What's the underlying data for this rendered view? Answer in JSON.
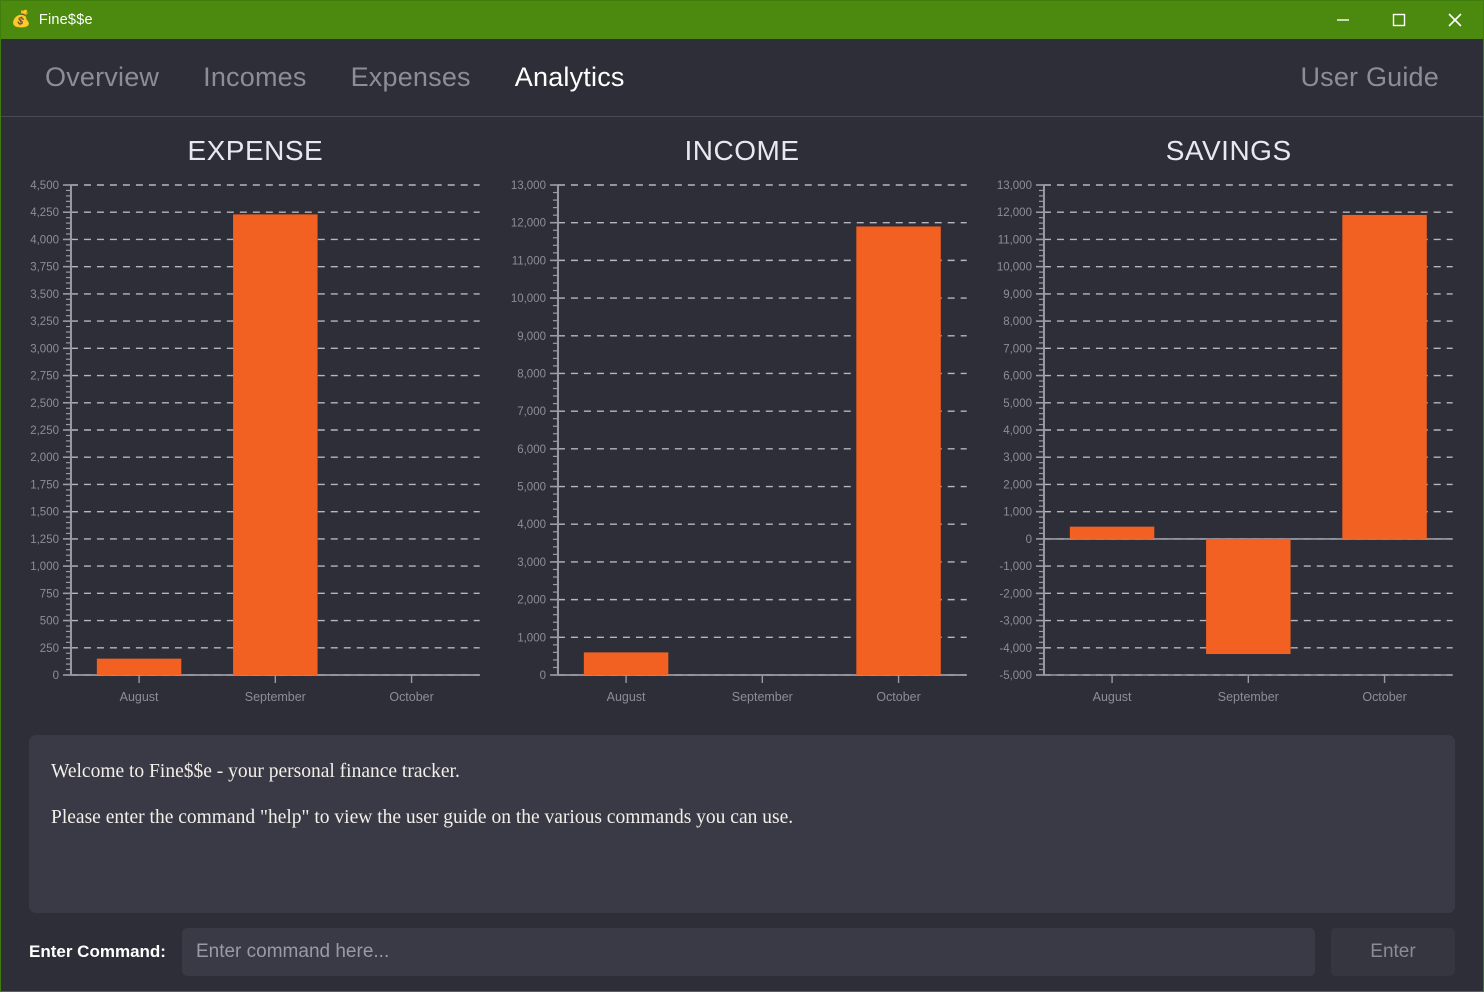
{
  "window": {
    "app_icon": "money-bag-icon",
    "app_icon_glyph": "💰",
    "title": "Fine$$e",
    "titlebar_color": "#4b8a0f",
    "controls": {
      "minimize": "minimize-icon",
      "maximize": "maximize-icon",
      "close": "close-icon"
    }
  },
  "nav": {
    "tabs": [
      {
        "label": "Overview",
        "active": false
      },
      {
        "label": "Incomes",
        "active": false
      },
      {
        "label": "Expenses",
        "active": false
      },
      {
        "label": "Analytics",
        "active": true
      }
    ],
    "user_guide": "User Guide"
  },
  "theme": {
    "background": "#2e2e38",
    "panel": "#3a3a46",
    "bar_color": "#f26122",
    "accent_green": "#4b8a0f",
    "text_muted": "#8d8d98",
    "text": "#ffffff"
  },
  "chart_data": [
    {
      "type": "bar",
      "title": "EXPENSE",
      "categories": [
        "August",
        "September",
        "October"
      ],
      "values": [
        150,
        4230,
        0
      ],
      "xlabel": "",
      "ylabel": "",
      "ylim": [
        0,
        4500
      ],
      "ytick_step": 250,
      "yticks": [
        "0",
        "250",
        "500",
        "750",
        "1,000",
        "1,250",
        "1,500",
        "1,750",
        "2,000",
        "2,250",
        "2,500",
        "2,750",
        "3,000",
        "3,250",
        "3,500",
        "3,750",
        "4,000",
        "4,250",
        "4,500"
      ],
      "grid": true,
      "legend": false,
      "bar_color": "#f26122"
    },
    {
      "type": "bar",
      "title": "INCOME",
      "categories": [
        "August",
        "September",
        "October"
      ],
      "values": [
        600,
        0,
        11900
      ],
      "xlabel": "",
      "ylabel": "",
      "ylim": [
        0,
        13000
      ],
      "ytick_step": 1000,
      "yticks": [
        "0",
        "1,000",
        "2,000",
        "3,000",
        "4,000",
        "5,000",
        "6,000",
        "7,000",
        "8,000",
        "9,000",
        "10,000",
        "11,000",
        "12,000",
        "13,000"
      ],
      "grid": true,
      "legend": false,
      "bar_color": "#f26122"
    },
    {
      "type": "bar",
      "title": "SAVINGS",
      "categories": [
        "August",
        "September",
        "October"
      ],
      "values": [
        450,
        -4230,
        11900
      ],
      "xlabel": "",
      "ylabel": "",
      "ylim": [
        -5000,
        13000
      ],
      "ytick_step": 1000,
      "yticks": [
        "-5,000",
        "-4,000",
        "-3,000",
        "-2,000",
        "-1,000",
        "0",
        "1,000",
        "2,000",
        "3,000",
        "4,000",
        "5,000",
        "6,000",
        "7,000",
        "8,000",
        "9,000",
        "10,000",
        "11,000",
        "12,000",
        "13,000"
      ],
      "grid": true,
      "legend": false,
      "bar_color": "#f26122"
    }
  ],
  "console": {
    "lines": [
      "Welcome to Fine$$e - your personal finance tracker.",
      "Please enter the command \"help\" to view the user guide on the various commands you can use."
    ]
  },
  "command_bar": {
    "label": "Enter Command:",
    "input_value": "",
    "placeholder": "Enter command here...",
    "button_label": "Enter"
  }
}
